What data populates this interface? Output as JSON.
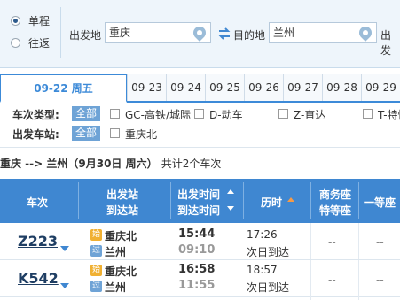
{
  "trip": {
    "one_way": "单程",
    "round_trip": "往返",
    "depart_label": "出发地",
    "depart_value": "重庆",
    "dest_label": "目的地",
    "dest_value": "兰州",
    "date_label_cut": "出发"
  },
  "dates": {
    "active": "09-22 周五",
    "tabs": [
      "09-23",
      "09-24",
      "09-25",
      "09-26",
      "09-27",
      "09-28",
      "09-29"
    ]
  },
  "filters": {
    "type_label": "车次类型:",
    "all": "全部",
    "types": [
      "GC-高铁/城际",
      "D-动车",
      "Z-直达",
      "T-特快"
    ],
    "station_label": "出发车站:",
    "stations": [
      "重庆北"
    ]
  },
  "summary": {
    "route": "重庆 --> 兰州（9月30日  周六）",
    "count": "共计2个车次"
  },
  "table_header": {
    "train": "车次",
    "dep_station": "出发站",
    "arr_station": "到达站",
    "dep_time": "出发时间",
    "arr_time": "到达时间",
    "duration": "历时",
    "business": "商务座",
    "premium": "特等座",
    "first": "一等座"
  },
  "trains": [
    {
      "number": "Z223",
      "start_badge": "始",
      "pass_badge": "过",
      "from": "重庆北",
      "to": "兰州",
      "depart": "15:44",
      "arrive": "09:10",
      "duration": "17:26",
      "arrive_note": "次日到达",
      "business": "--",
      "first": "--"
    },
    {
      "number": "K542",
      "start_badge": "始",
      "pass_badge": "过",
      "from": "重庆北",
      "to": "兰州",
      "depart": "16:58",
      "arrive": "11:55",
      "duration": "18:57",
      "arrive_note": "次日到达",
      "business": "--",
      "first": "--"
    }
  ]
}
